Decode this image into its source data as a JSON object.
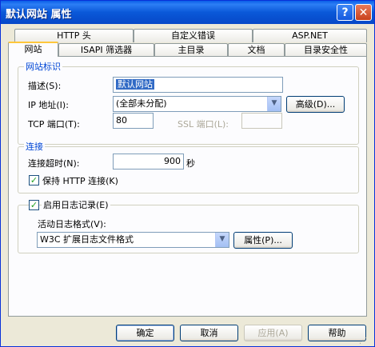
{
  "window": {
    "title": "默认网站 属性",
    "help_glyph": "?",
    "close_glyph": "✕"
  },
  "tabs": {
    "row1": [
      "HTTP 头",
      "自定义错误",
      "ASP.NET"
    ],
    "row2": [
      "网站",
      "ISAPI 筛选器",
      "主目录",
      "文档",
      "目录安全性"
    ],
    "active": "网站"
  },
  "site_id": {
    "legend": "网站标识",
    "desc_label": "描述(S):",
    "desc_value": "默认网站",
    "ip_label": "IP 地址(I):",
    "ip_value": "(全部未分配)",
    "advanced_button": "高级(D)...",
    "tcp_label": "TCP 端口(T):",
    "tcp_value": "80",
    "ssl_label": "SSL 端口(L):",
    "ssl_value": ""
  },
  "connection": {
    "legend": "连接",
    "timeout_label": "连接超时(N):",
    "timeout_value": "900",
    "timeout_unit": "秒",
    "keepalive_label": "保持 HTTP 连接(K)",
    "keepalive_checked": true
  },
  "logging": {
    "enable_label": "启用日志记录(E)",
    "enable_checked": true,
    "format_label": "活动日志格式(V):",
    "format_value": "W3C 扩展日志文件格式",
    "properties_button": "属性(P)..."
  },
  "buttons": {
    "ok": "确定",
    "cancel": "取消",
    "apply": "应用(A)",
    "help": "帮助"
  },
  "icons": {
    "dropdown": "chevron-down-icon",
    "check": "checkmark-icon"
  }
}
